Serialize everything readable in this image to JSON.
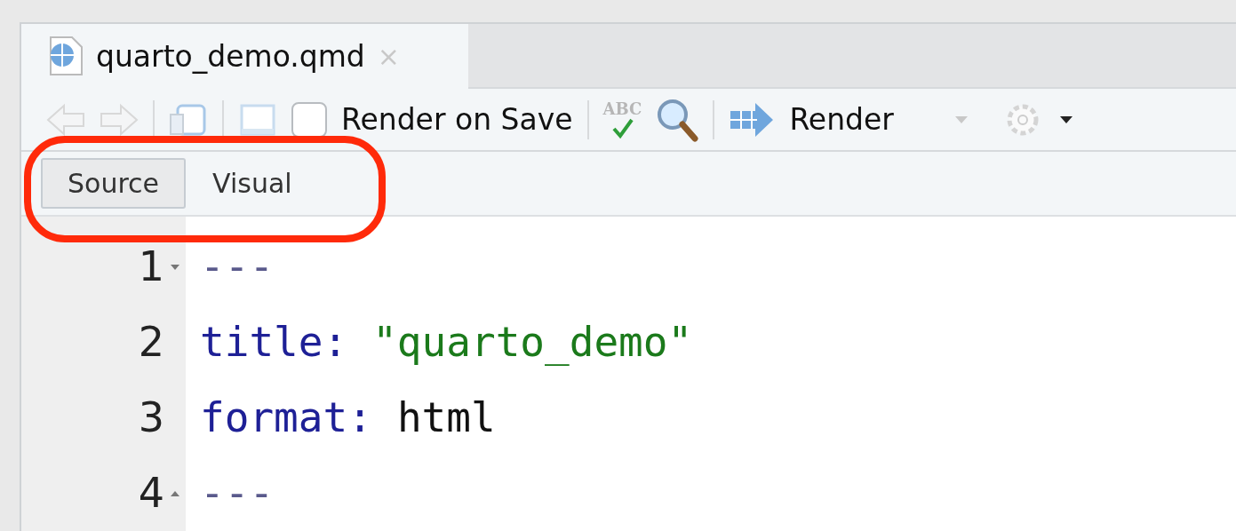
{
  "editor_tab": {
    "filename": "quarto_demo.qmd",
    "close": "×"
  },
  "toolbar": {
    "render_on_save": {
      "label": "Render on Save",
      "checked": false
    },
    "spellcheck_label": "ABC",
    "render_label": "Render"
  },
  "mode_buttons": [
    {
      "label": "Source",
      "selected": true
    },
    {
      "label": "Visual",
      "selected": false
    }
  ],
  "highlight_ring": true,
  "code_lines": [
    {
      "number": "1",
      "kind": "fold-start",
      "tokens": [
        {
          "kind": "delimiter",
          "text": "---"
        }
      ]
    },
    {
      "number": "2",
      "kind": "code",
      "tokens": [
        {
          "kind": "key",
          "text": "title:"
        },
        {
          "kind": "string",
          "text": "\"quarto_demo\""
        }
      ]
    },
    {
      "number": "3",
      "kind": "code",
      "tokens": [
        {
          "kind": "key",
          "text": "format:"
        },
        {
          "kind": "plain",
          "text": "html"
        }
      ]
    },
    {
      "number": "4",
      "kind": "fold-end",
      "tokens": [
        {
          "kind": "delimiter",
          "text": "---"
        }
      ]
    }
  ]
}
